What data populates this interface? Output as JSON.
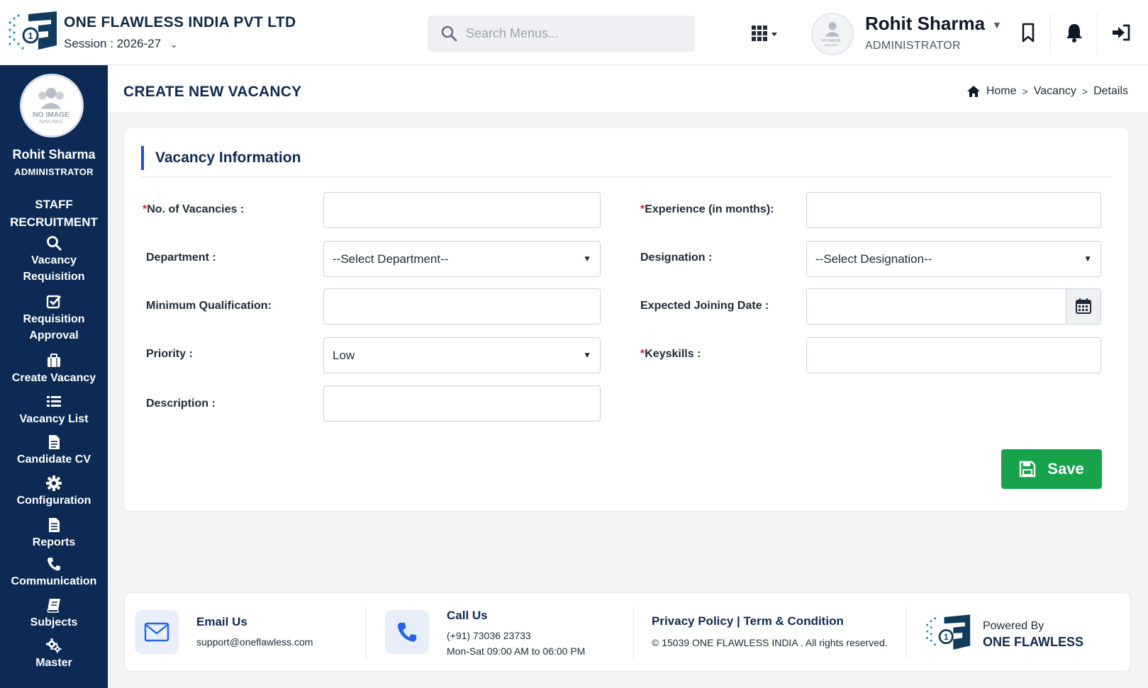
{
  "header": {
    "company": "ONE FLAWLESS INDIA PVT LTD",
    "session_label": "Session :",
    "session_value": "2026-27",
    "search_placeholder": "Search Menus...",
    "user_name": "Rohit Sharma",
    "user_role": "ADMINISTRATOR",
    "avatar_text_1": "NO IMAGE",
    "avatar_text_2": "AVAILABLE"
  },
  "sidebar": {
    "user_name": "Rohit Sharma",
    "user_role": "ADMINISTRATOR",
    "section_line1": "STAFF",
    "section_line2": "RECRUITMENT",
    "items": [
      {
        "line1": "Vacancy",
        "line2": "Requisition",
        "icon": "search-icon"
      },
      {
        "line1": "Requisition",
        "line2": "Approval",
        "icon": "checkbox-icon"
      },
      {
        "line1": "Create Vacancy",
        "line2": "",
        "icon": "briefcase-icon"
      },
      {
        "line1": "Vacancy List",
        "line2": "",
        "icon": "list-icon"
      },
      {
        "line1": "Candidate CV",
        "line2": "",
        "icon": "document-icon"
      },
      {
        "line1": "Configuration",
        "line2": "",
        "icon": "gear-icon"
      },
      {
        "line1": "Reports",
        "line2": "",
        "icon": "report-icon"
      },
      {
        "line1": "Communication",
        "line2": "",
        "icon": "phone-icon"
      },
      {
        "line1": "Subjects",
        "line2": "",
        "icon": "book-icon"
      },
      {
        "line1": "Master",
        "line2": "",
        "icon": "gears-icon"
      }
    ]
  },
  "page": {
    "title": "CREATE NEW VACANCY",
    "breadcrumb": [
      "Home",
      "Vacancy",
      "Details"
    ]
  },
  "form": {
    "section_title": "Vacancy Information",
    "fields": {
      "no_of_vacancies": {
        "label": "No. of Vacancies :",
        "required": "*",
        "value": ""
      },
      "experience": {
        "label": "Experience (in months):",
        "required": "*",
        "value": ""
      },
      "department": {
        "label": "Department :",
        "selected": "--Select Department--"
      },
      "designation": {
        "label": "Designation :",
        "selected": "--Select Designation--"
      },
      "min_qualification": {
        "label": "Minimum Qualification:",
        "value": ""
      },
      "joining_date": {
        "label": "Expected Joining Date :",
        "value": ""
      },
      "priority": {
        "label": "Priority :",
        "selected": "Low"
      },
      "keyskills": {
        "label": "Keyskills :",
        "required": "*",
        "value": ""
      },
      "description": {
        "label": "Description :",
        "value": ""
      }
    },
    "save_label": "Save"
  },
  "footer": {
    "email_title": "Email Us",
    "email_value": "support@oneflawless.com",
    "call_title": "Call Us",
    "call_number": "(+91) 73036 23733",
    "call_hours": "Mon-Sat 09:00 AM to 06:00 PM",
    "policy": "Privacy Policy | Term & Condition",
    "copyright": "© 15039 ONE FLAWLESS INDIA . All rights reserved.",
    "powered_label": "Powered By",
    "powered_brand": "ONE FLAWLESS"
  },
  "colors": {
    "sidebar_bg": "#0d2a55",
    "accent_blue": "#1d4ed8",
    "save_green": "#16a34a",
    "required_red": "#dc2626"
  }
}
